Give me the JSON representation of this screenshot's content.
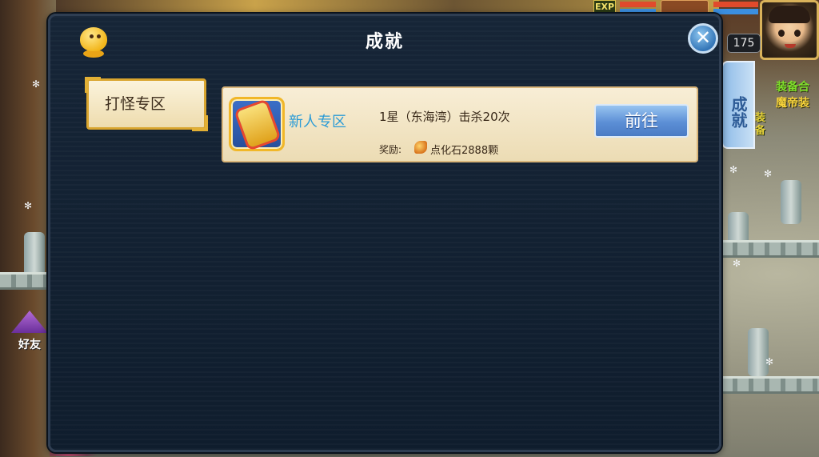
{
  "hud": {
    "exp_label": "EXP",
    "level": "175",
    "side_tab": "成就",
    "side_text_1": "装备合",
    "side_text_2": "魔帝装",
    "side_text_3": "装备",
    "friend_label": "好友"
  },
  "dialog": {
    "title": "成就",
    "close_icon": "close-x",
    "categories": [
      {
        "label": "打怪专区",
        "selected": true
      }
    ],
    "tasks": [
      {
        "icon": "scroll-icon",
        "name": "新人专区",
        "description": "1星（东海湾）击杀20次",
        "reward_label": "奖励:",
        "reward_icon": "stone-icon",
        "reward_value": "点化石2888颗",
        "button_label": "前往"
      }
    ]
  },
  "colors": {
    "dialog_bg": "#132235",
    "row_bg": "#f4e8c8",
    "accent_blue": "#2a9bd6",
    "button_blue": "#5c8fd6",
    "frame_gold": "#d9a52e"
  }
}
